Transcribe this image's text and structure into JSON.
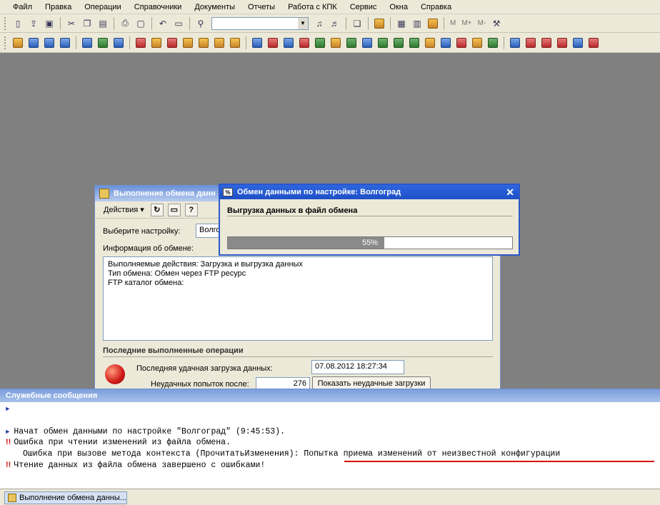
{
  "menu": [
    "Файл",
    "Правка",
    "Операции",
    "Справочники",
    "Документы",
    "Отчеты",
    "Работа с КПК",
    "Сервис",
    "Окна",
    "Справка"
  ],
  "toolbar": {
    "m_labels": [
      "M",
      "M+",
      "M-"
    ]
  },
  "exchange_window": {
    "title": "Выполнение обмена данн",
    "actions_label": "Действия",
    "select_setting_label": "Выберите настройку:",
    "select_setting_value": "Волго",
    "info_label": "Информация об обмене:",
    "info_lines": [
      "Выполняемые действия: Загрузка и выгрузка данных",
      "Тип обмена:  Обмен через FTP ресурс",
      "FTP каталог обмена:"
    ],
    "section_title": "Последние выполненные операции",
    "last_success_label": "Последняя удачная загрузка данных:",
    "last_success_value": "07.08.2012 18:27:34",
    "failed_attempts_label": "Неудачных попыток после:",
    "failed_attempts_value": "276",
    "show_failed_button": "Показать неудачные загрузки"
  },
  "progress_dialog": {
    "title": "Обмен данными по настройке: Волгоград",
    "label": "Выгрузка данных в файл обмена",
    "progress": 55,
    "progress_text": "55%"
  },
  "messages": {
    "title": "Служебные сообщения",
    "lines": [
      {
        "marker": "arrow",
        "text": ""
      },
      {
        "marker": "arrow",
        "text": "Начат обмен данными по настройке \"Волгоград\" (9:45:53)."
      },
      {
        "marker": "error",
        "text": "Ошибка при чтении изменений из файла обмена."
      },
      {
        "marker": "none",
        "text": "Ошибка при вызове метода контекста (ПрочитатьИзменения): Попытка приема изменений от неизвестной конфигурации"
      },
      {
        "marker": "error",
        "text": "Чтение данных из файла обмена завершено с ошибками!"
      }
    ]
  },
  "taskbar": {
    "task_label": "Выполнение обмена данны..."
  },
  "colors": {
    "accent": "#2b57c8",
    "error": "#d01010",
    "progress_fill": "#8a8a8a"
  }
}
